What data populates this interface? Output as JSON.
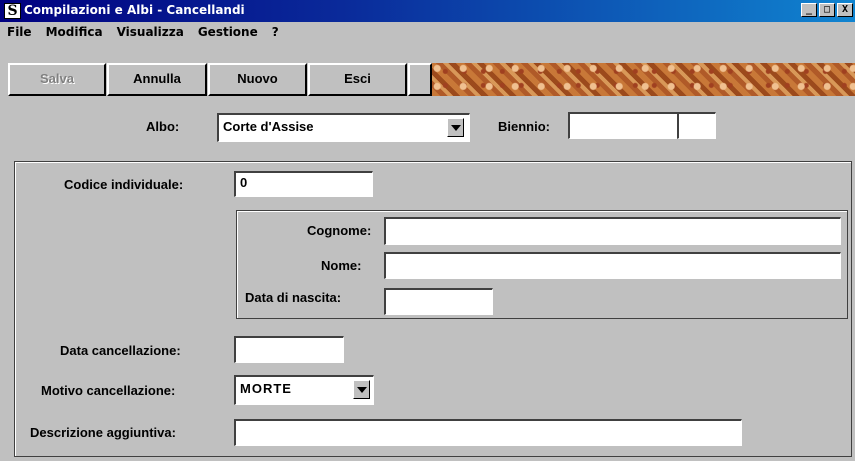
{
  "window": {
    "title": "Compilazioni e Albi - Cancellandi",
    "icon": "S",
    "controls": [
      "_",
      "□",
      "X"
    ]
  },
  "menu": [
    "File",
    "Modifica",
    "Visualizza",
    "Gestione",
    "?"
  ],
  "toolbar": {
    "save_label": "Salva",
    "cancel_label": "Annulla",
    "new_label": "Nuovo",
    "exit_label": "Esci"
  },
  "header": {
    "albo_label": "Albo:",
    "albo_value": "Corte d'Assise",
    "biennio_label": "Biennio:",
    "biennio_value": ""
  },
  "form": {
    "codice_label": "Codice individuale:",
    "codice_value": "0",
    "cognome_label": "Cognome:",
    "cognome_value": "",
    "nome_label": "Nome:",
    "nome_value": "",
    "nascita_label": "Data di nascita:",
    "nascita_value": "",
    "data_canc_label": "Data cancellazione:",
    "data_canc_value": "",
    "motivo_label": "Motivo cancellazione:",
    "motivo_value": "MORTE",
    "descr_label": "Descrizione aggiuntiva:",
    "descr_value": ""
  }
}
